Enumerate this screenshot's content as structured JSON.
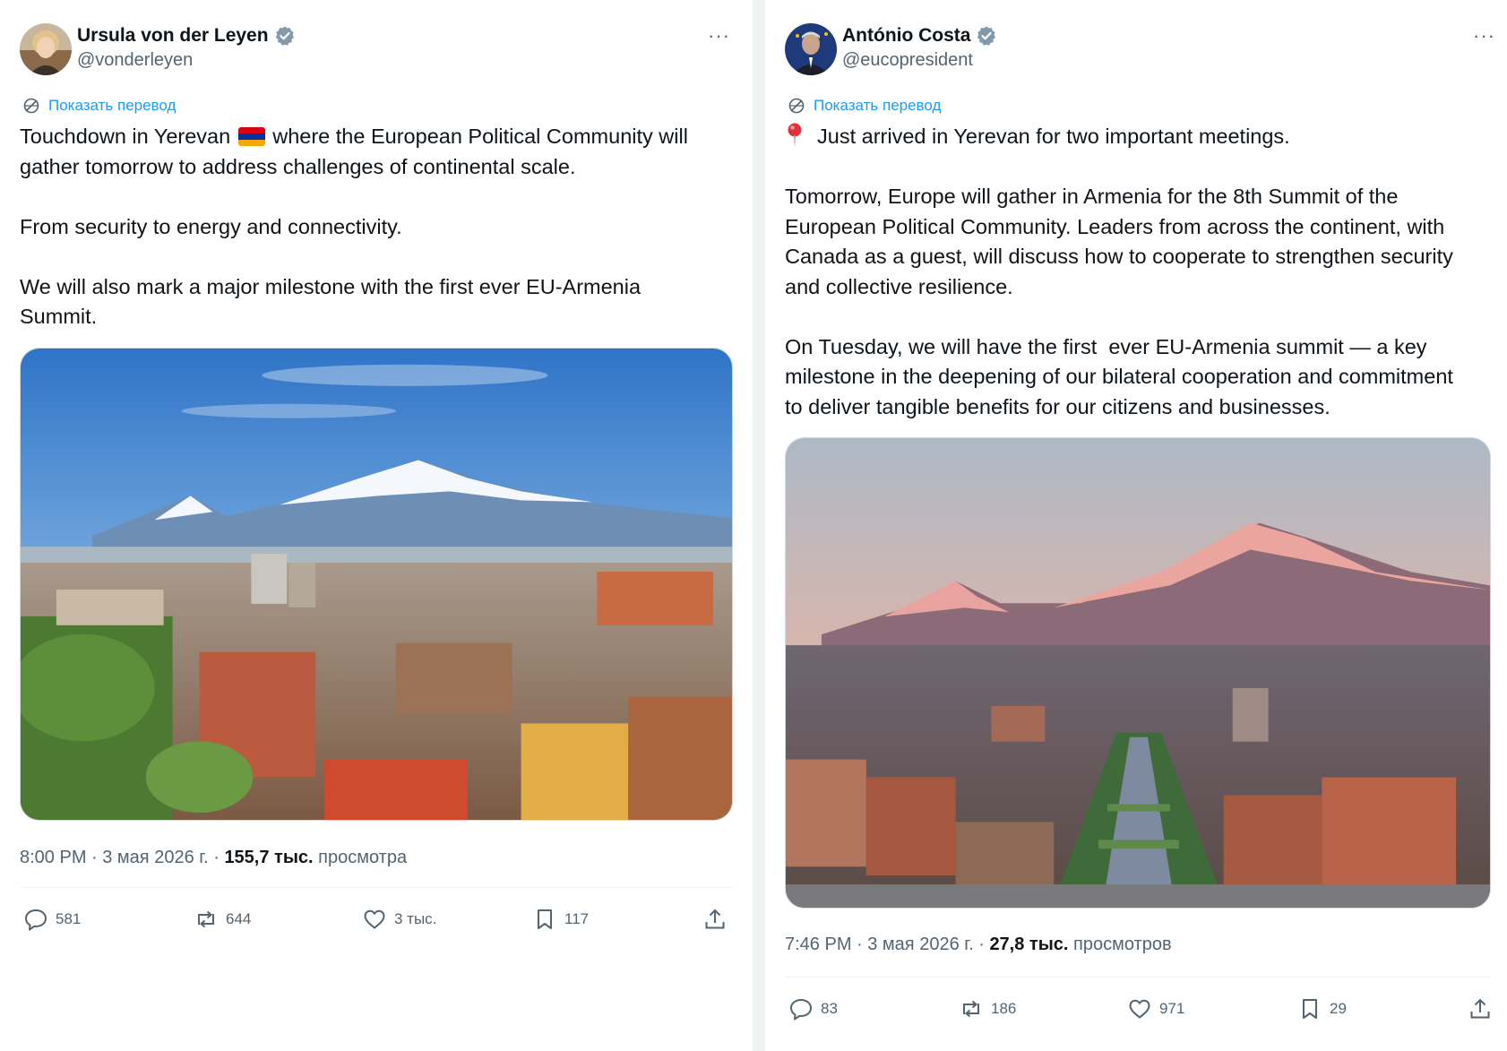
{
  "left_tweet": {
    "author_name": "Ursula von der Leyen",
    "handle": "@vonderleyen",
    "more": "···",
    "translate": "Показать перевод",
    "text_line1_a": "Touchdown in Yerevan ",
    "text_line1_b": " where the European Political Community will",
    "text_line2": "gather tomorrow to address challenges of continental scale.",
    "text_p2": "From security to energy and connectivity.",
    "text_p3": "We will also mark a major milestone with the first ever EU-Armenia\nSummit.",
    "flag_colors": [
      "#d90012",
      "#0033a0",
      "#f2a800"
    ],
    "meta_time": "8:00 PM · 3 мая 2026 г. · ",
    "meta_views_count": "155,7 тыс.",
    "meta_views_label": " просмотра",
    "actions": {
      "replies": "581",
      "reposts": "644",
      "likes": "3 тыс.",
      "bookmarks": "117"
    }
  },
  "right_tweet": {
    "author_name": "António Costa",
    "handle": "@eucopresident",
    "more": "···",
    "translate": "Показать перевод",
    "text_line1": "Just arrived in Yerevan for two important meetings.",
    "text_p2": "Tomorrow, Europe will gather in Armenia for the 8th Summit of the\nEuropean Political Community. Leaders from across the continent, with\nCanada as a guest, will discuss how to cooperate to strengthen security\nand collective resilience.",
    "text_p3": "On Tuesday, we will have the first  ever EU-Armenia summit — a key\nmilestone in the deepening of our bilateral cooperation and commitment\nto deliver tangible benefits for our citizens and businesses.",
    "meta_time": "7:46 PM · 3 мая 2026 г. · ",
    "meta_views_count": "27,8 тыс.",
    "meta_views_label": " просмотров",
    "actions": {
      "replies": "83",
      "reposts": "186",
      "likes": "971",
      "bookmarks": "29"
    }
  },
  "colors": {
    "link_blue": "#1d9bf0",
    "secondary_text": "#536471",
    "verified_badge": "#829aab",
    "divider": "#eff3f4"
  },
  "icons": {
    "reply": "speech-bubble-icon",
    "repost": "repost-arrows-icon",
    "like": "heart-icon",
    "bookmark": "bookmark-icon",
    "share": "upload-share-icon",
    "translate": "translate-globe-icon",
    "verified": "verified-badge-icon",
    "pin": "round-pushpin-icon"
  }
}
